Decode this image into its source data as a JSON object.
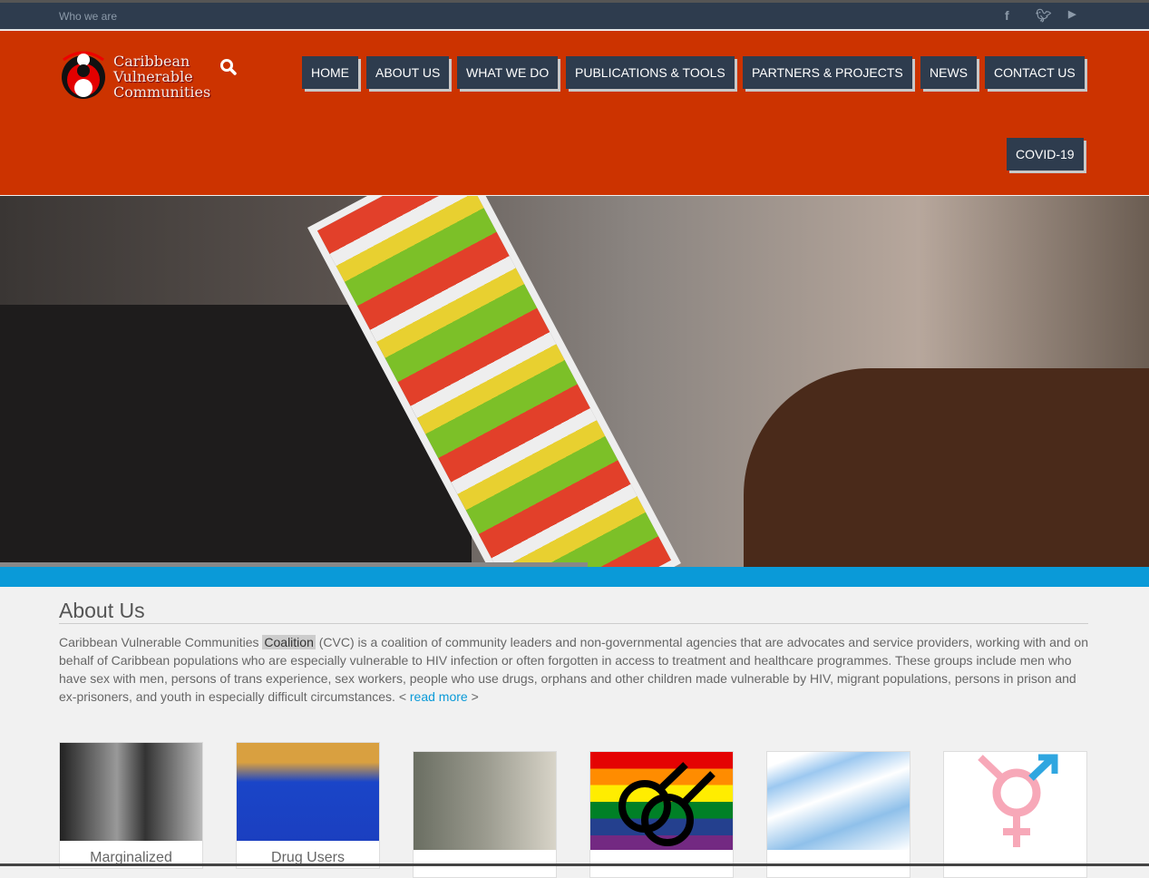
{
  "topbar": {
    "who_label": "Who we are",
    "social": [
      "facebook-icon",
      "twitter-icon",
      "youtube-icon"
    ]
  },
  "logo": {
    "line1": "Caribbean",
    "line2": "Vulnerable",
    "line3": "Communities"
  },
  "nav": [
    "HOME",
    "ABOUT US",
    "WHAT WE DO",
    "PUBLICATIONS & TOOLS",
    "PARTNERS & PROJECTS",
    "NEWS",
    "CONTACT US",
    "COVID-19"
  ],
  "about": {
    "title": "About Us",
    "pre": "Caribbean Vulnerable Communities ",
    "highlight": "Coalition",
    "post": " (CVC) is a coalition of community leaders and non-governmental agencies that are advocates and service providers, working with and on behalf of Caribbean populations who are especially vulnerable to HIV infection or often forgotten in access to treatment and healthcare programmes. These groups include men who have sex with men, persons of trans experience, sex workers, people who use drugs, orphans and other children made vulnerable by HIV, migrant populations, persons in prison and ex-prisoners, and youth in especially difficult circumstances. ",
    "lt": "< ",
    "read_more": "read more",
    "gt": " >"
  },
  "cards": [
    {
      "label": "Marginalized"
    },
    {
      "label": "Drug Users"
    },
    {
      "label": ""
    },
    {
      "label": ""
    },
    {
      "label": ""
    },
    {
      "label": ""
    }
  ],
  "colors": {
    "header": "#cc3300",
    "topbar": "#2e3c4e",
    "accent": "#0a9ad8"
  }
}
